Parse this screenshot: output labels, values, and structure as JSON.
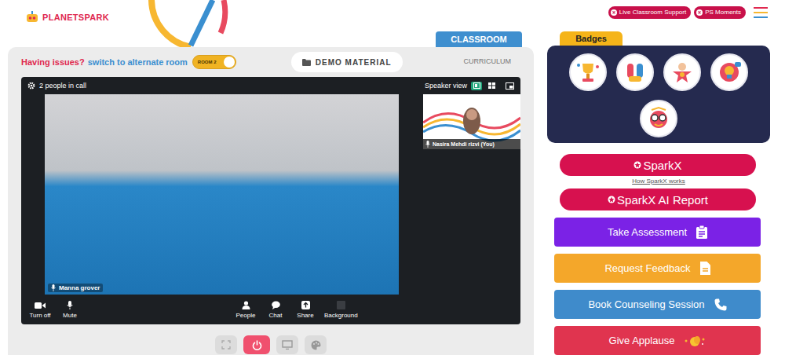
{
  "header": {
    "logo": "PLANETSPARK",
    "buttons": [
      {
        "label": "Live Classroom Support"
      },
      {
        "label": "PS Moments"
      }
    ]
  },
  "classroom_tabs": [
    {
      "label": "CLASSROOM",
      "selected": true
    },
    {
      "label": "CURRICULUM",
      "selected": false
    }
  ],
  "issue_bar": {
    "question": "Having issues?",
    "link": "switch to alternate room",
    "toggle": {
      "label": "ROOM 2",
      "on": true
    }
  },
  "demo_material": {
    "label": "DEMO MATERIAL"
  },
  "call": {
    "people": "2 people in call",
    "view_label": "Speaker view",
    "view_modes": [
      {
        "kind": "speaker",
        "selected": true
      },
      {
        "kind": "grid",
        "selected": false
      }
    ],
    "main_participant": {
      "name": "Manna grover"
    },
    "self_participant": {
      "name": "Nasira Mehdi rizvi (You)"
    },
    "controls_left": [
      {
        "kind": "camera",
        "label": "Turn off"
      },
      {
        "kind": "mic",
        "label": "Mute"
      }
    ],
    "controls_center": [
      {
        "kind": "people",
        "label": "People"
      },
      {
        "kind": "chat",
        "label": "Chat"
      },
      {
        "kind": "share",
        "label": "Share"
      },
      {
        "kind": "background",
        "label": "Background"
      }
    ]
  },
  "room_controls": [
    {
      "kind": "fullscreen",
      "selected": false
    },
    {
      "kind": "leave",
      "selected": true
    },
    {
      "kind": "screen",
      "selected": false
    },
    {
      "kind": "palette",
      "selected": false
    }
  ],
  "badges": {
    "title": "Badges",
    "items": [
      {
        "kind": "trophy"
      },
      {
        "kind": "teamwork"
      },
      {
        "kind": "star"
      },
      {
        "kind": "idea"
      },
      {
        "kind": "geek"
      }
    ]
  },
  "actions": [
    {
      "kind": "pill",
      "label": "SparkX",
      "help": "How SparkX works",
      "color": "#d7114f"
    },
    {
      "kind": "pill",
      "label": "SparkX AI Report",
      "help": "",
      "color": "#d7114f"
    },
    {
      "kind": "assessment",
      "label": "Take Assessment",
      "help": "",
      "color": "#7b22e6"
    },
    {
      "kind": "feedback",
      "label": "Request Feedback",
      "help": "",
      "color": "#f4a72a"
    },
    {
      "kind": "counseling",
      "label": "Book Counseling Session",
      "help": "",
      "color": "#3f8bcb"
    },
    {
      "kind": "applause",
      "label": "Give Applause",
      "help": "",
      "color": "#e0344f"
    }
  ]
}
